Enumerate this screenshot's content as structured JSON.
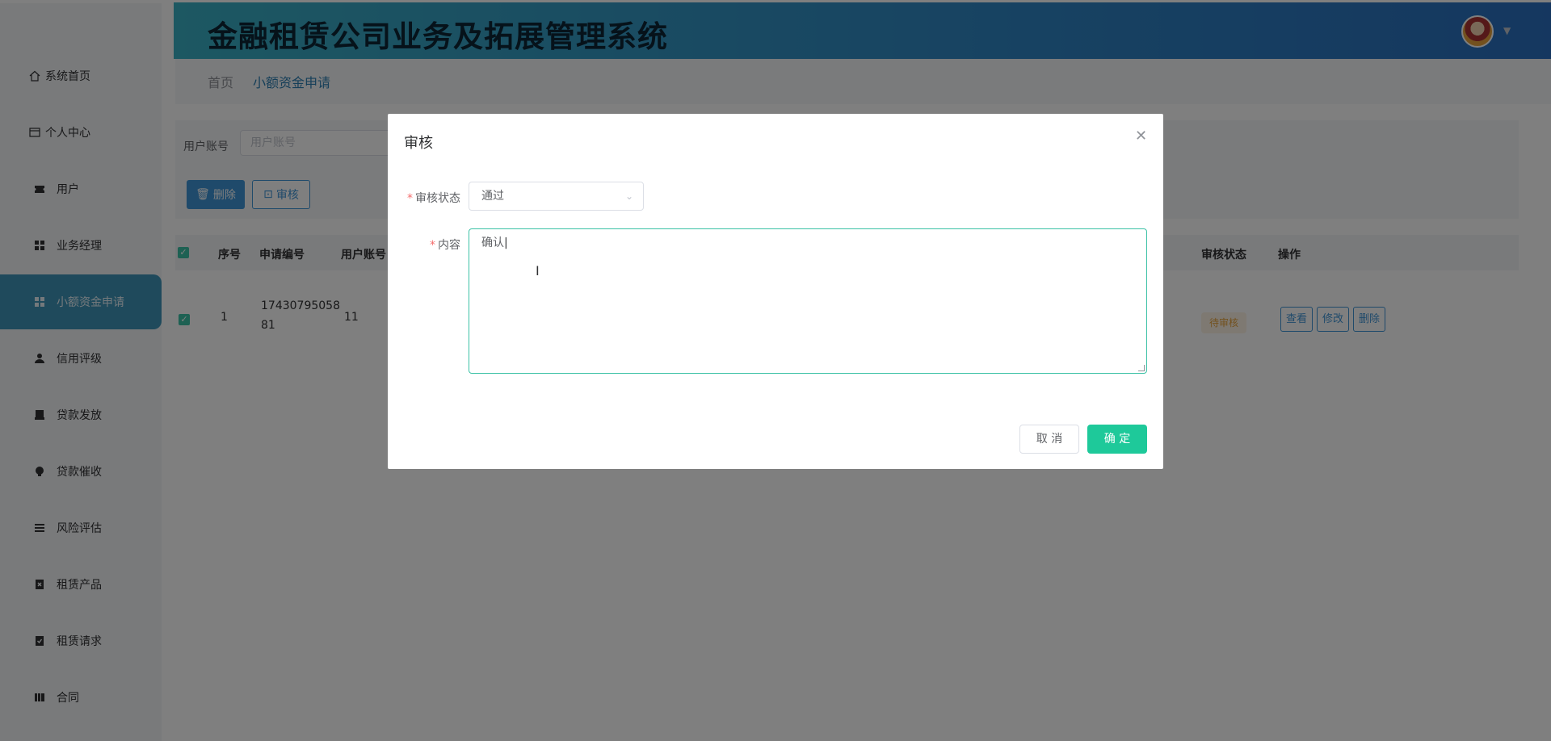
{
  "app": {
    "title": "金融租赁公司业务及拓展管理系统"
  },
  "sidebar": {
    "items": [
      {
        "label": "系统首页",
        "icon": "home-icon"
      },
      {
        "label": "个人中心",
        "icon": "profile-card-icon"
      },
      {
        "label": "用户",
        "icon": "ticket-icon"
      },
      {
        "label": "业务经理",
        "icon": "grid-icon"
      },
      {
        "label": "小额资金申请",
        "icon": "grid-icon",
        "active": true
      },
      {
        "label": "信用评级",
        "icon": "user-icon"
      },
      {
        "label": "贷款发放",
        "icon": "printer-icon"
      },
      {
        "label": "贷款催收",
        "icon": "lightbulb-icon"
      },
      {
        "label": "风险评估",
        "icon": "list-icon"
      },
      {
        "label": "租赁产品",
        "icon": "clipboard-x-icon"
      },
      {
        "label": "租赁请求",
        "icon": "clipboard-check-icon"
      },
      {
        "label": "合同",
        "icon": "book-icon"
      }
    ]
  },
  "breadcrumb": {
    "home": "首页",
    "current": "小额资金申请"
  },
  "search": {
    "label": "用户账号",
    "placeholder": "用户账号"
  },
  "toolbar": {
    "delete_label": "删除",
    "audit_label": "审核"
  },
  "table": {
    "columns": [
      "序号",
      "申请编号",
      "用户账号",
      "审核状态",
      "操作"
    ],
    "rows": [
      {
        "index": "1",
        "app_no_line1": "17430795058",
        "app_no_line2": "81",
        "account": "11",
        "status": "待审核",
        "actions": [
          "查看",
          "修改",
          "删除"
        ]
      }
    ]
  },
  "dialog": {
    "title": "审核",
    "status_label": "审核状态",
    "status_value": "通过",
    "content_label": "内容",
    "content_value": "确认",
    "cancel_label": "取 消",
    "confirm_label": "确 定"
  },
  "colors": {
    "accent": "#1ec99a",
    "primary": "#3f95d6",
    "sidebar_active": "#3f95b8",
    "warning": "#e6a23c"
  }
}
